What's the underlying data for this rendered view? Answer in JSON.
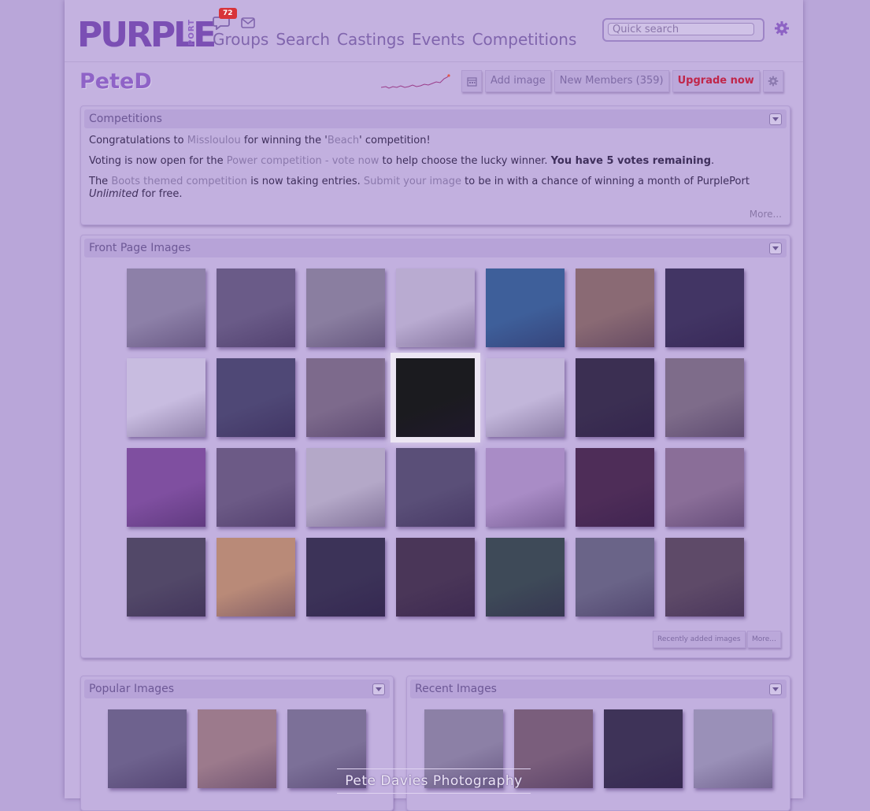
{
  "header": {
    "logo_text": "PURPLE",
    "logo_sub": "PORT",
    "message_count": "72",
    "nav": [
      "Groups",
      "Search",
      "Castings",
      "Events",
      "Competitions"
    ],
    "search_placeholder": "Quick search"
  },
  "profile": {
    "username": "PeteD",
    "buttons": {
      "add_image": "Add image",
      "new_members": "New Members (359)",
      "upgrade": "Upgrade now"
    }
  },
  "competitions": {
    "title": "Competitions",
    "line1": {
      "t1": "Congratulations to ",
      "winner": "Missloulou",
      "t2": " for winning the '",
      "comp": "Beach",
      "t3": "' competition!"
    },
    "line2": {
      "t1": "Voting is now open for the ",
      "link": "Power competition - vote now",
      "t2": " to help choose the lucky winner. ",
      "bold": "You have 5 votes remaining",
      "t3": "."
    },
    "line3": {
      "t1": "The ",
      "link1": "Boots themed competition",
      "t2": " is now taking entries. ",
      "link2": "Submit your image",
      "t3": " to be in with a chance of winning a month of PurplePort ",
      "italic": "Unlimited",
      "t4": " for free."
    },
    "more": "More..."
  },
  "front_page": {
    "title": "Front Page Images",
    "recent_btn": "Recently added images",
    "more_btn": "More...",
    "colors": [
      "#8d80a8",
      "#6a5b88",
      "#8a7ea0",
      "#b9abd1",
      "#3e5f9a",
      "#8a6a74",
      "#423564",
      "#c8bce0",
      "#4f4876",
      "#7d6a8c",
      "#1b1b1f",
      "#c2b6da",
      "#3b2f52",
      "#7e6c8a",
      "#7f4fa0",
      "#6c5a86",
      "#b4a8c8",
      "#5a4f78",
      "#a98cc6",
      "#4e2d58",
      "#8a6e98",
      "#524868",
      "#b98a78",
      "#3c3358",
      "#4a3658",
      "#3e4a58",
      "#6a6488",
      "#5e4a68"
    ]
  },
  "popular": {
    "title": "Popular Images",
    "colors": [
      "#6e628e",
      "#9c7a8c",
      "#7c7098"
    ]
  },
  "recent": {
    "title": "Recent Images",
    "colors": [
      "#8c80a6",
      "#7a5e7c",
      "#3e3358",
      "#9a90b8"
    ]
  },
  "watermark": "Pete Davies Photography"
}
